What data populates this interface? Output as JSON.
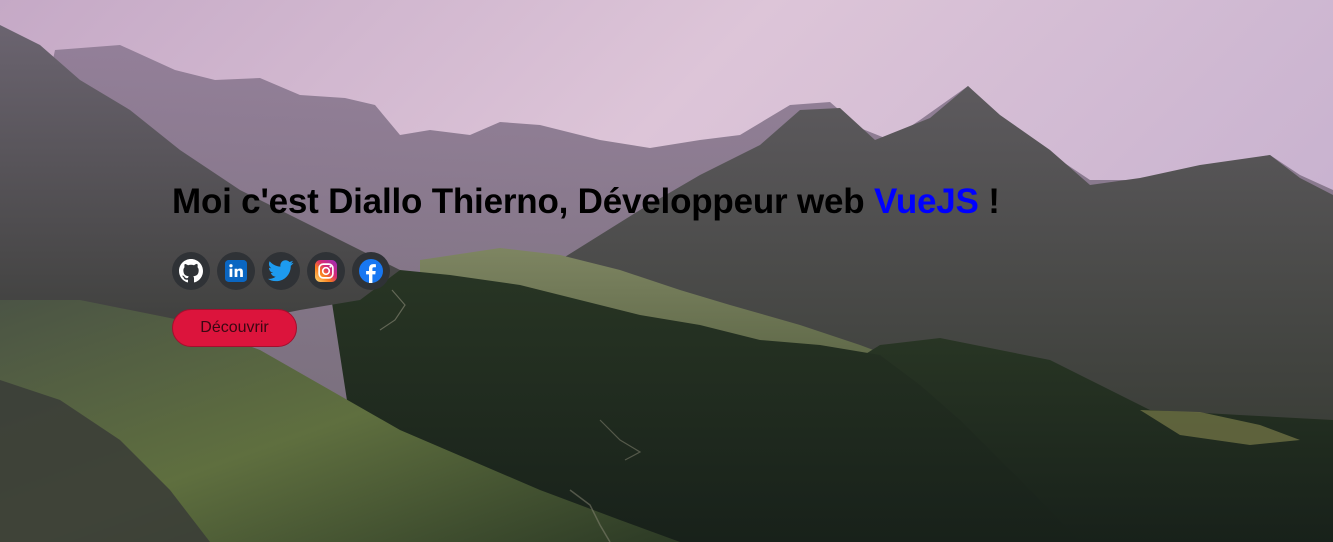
{
  "hero": {
    "headline_prefix": "Moi c'est Diallo Thierno, Développeur web ",
    "headline_accent": "VueJS",
    "headline_suffix": " !",
    "accent_color": "#0000ff",
    "cta_label": "Découvrir",
    "cta_color": "#dc143c"
  },
  "socials": [
    {
      "icon": "github-icon",
      "color": "#ffffff"
    },
    {
      "icon": "linkedin-icon",
      "color": "#0a66c2"
    },
    {
      "icon": "twitter-icon",
      "color": "#1d9bf0"
    },
    {
      "icon": "instagram-icon",
      "color": "#e1306c"
    },
    {
      "icon": "facebook-icon",
      "color": "#1877f2"
    }
  ]
}
